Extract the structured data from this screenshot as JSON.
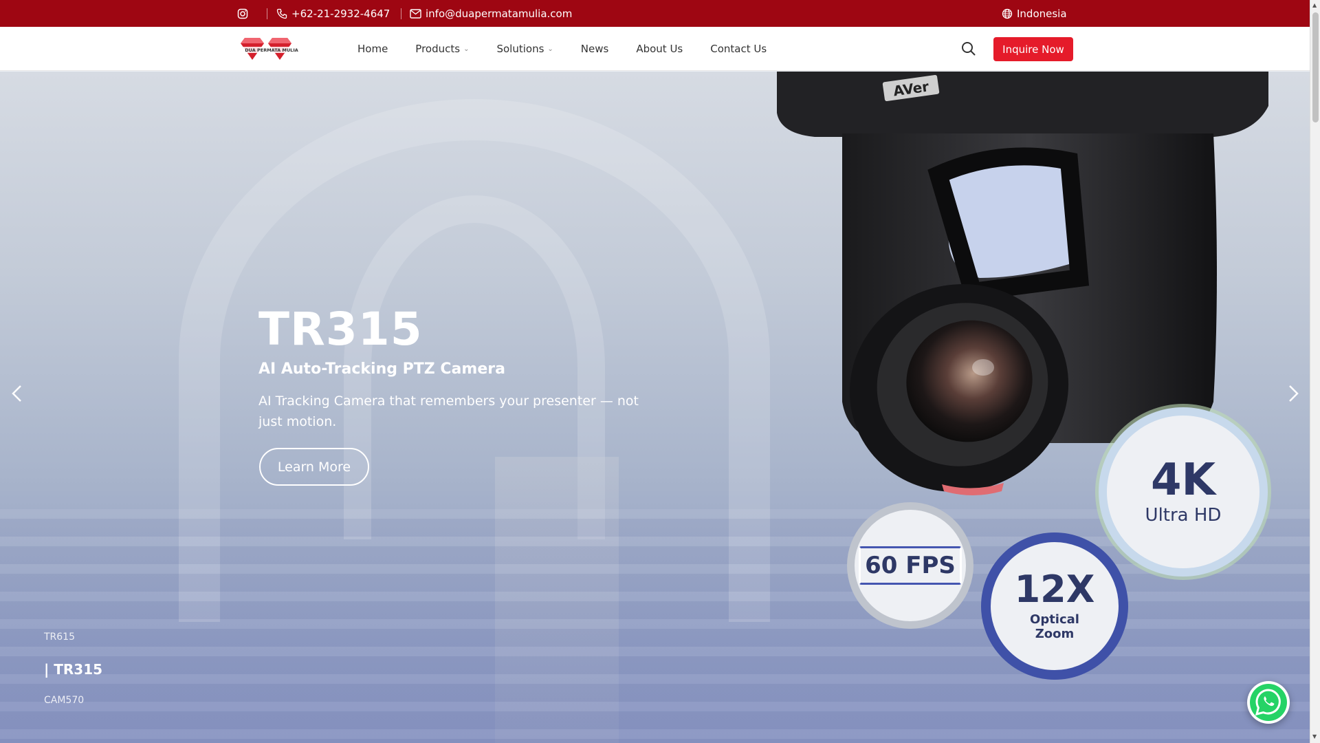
{
  "topbar": {
    "phone": "+62-21-2932-4647",
    "email": "info@duapermatamulia.com",
    "language": "Indonesia"
  },
  "nav": {
    "logo_text": "DUA PERMATA MULIA",
    "items": [
      {
        "label": "Home"
      },
      {
        "label": "Products"
      },
      {
        "label": "Solutions"
      },
      {
        "label": "News"
      },
      {
        "label": "About Us"
      },
      {
        "label": "Contact Us"
      }
    ],
    "inquire_label": "Inquire Now"
  },
  "hero": {
    "title": "TR315",
    "subtitle": "AI Auto-Tracking PTZ Camera",
    "description": "AI Tracking Camera that remembers your presenter — not just motion.",
    "button_label": "Learn More",
    "slides": [
      {
        "label": "TR615"
      },
      {
        "label": "| TR315"
      },
      {
        "label": "CAM570"
      }
    ],
    "active_slide": 1,
    "camera_brand": "AVer",
    "badges": {
      "res_big": "4K",
      "res_small": "Ultra HD",
      "fps": "60 FPS",
      "zoom_big": "12X",
      "zoom_line1": "Optical",
      "zoom_line2": "Zoom"
    }
  },
  "colors": {
    "topbar": "#9e0612",
    "accent": "#e51b2a",
    "whatsapp": "#25d366"
  }
}
